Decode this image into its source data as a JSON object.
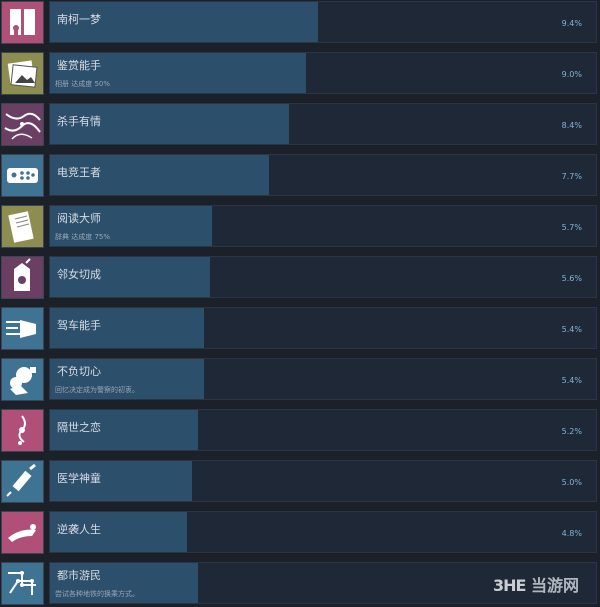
{
  "achievements": [
    {
      "title": "南柯一梦",
      "subtitle": "",
      "percent": "9.4%",
      "fill": 0.094,
      "color": "#b04f77",
      "icon": "door-icon"
    },
    {
      "title": "鉴赏能手",
      "subtitle": "相册 达成度 50%",
      "percent": "9.0%",
      "fill": 0.09,
      "color": "#8c8d4f",
      "icon": "photo-icon"
    },
    {
      "title": "杀手有情",
      "subtitle": "",
      "percent": "8.4%",
      "fill": 0.084,
      "color": "#6a3f63",
      "icon": "thorns-icon"
    },
    {
      "title": "电竞王者",
      "subtitle": "",
      "percent": "7.7%",
      "fill": 0.077,
      "color": "#3f7394",
      "icon": "gamepad-icon"
    },
    {
      "title": "阅读大师",
      "subtitle": "辞典 达成度 75%",
      "percent": "5.7%",
      "fill": 0.057,
      "color": "#8c8d4f",
      "icon": "book-icon"
    },
    {
      "title": "邻女切成",
      "subtitle": "",
      "percent": "5.6%",
      "fill": 0.056,
      "color": "#6a3f63",
      "icon": "milk-carton-icon"
    },
    {
      "title": "驾车能手",
      "subtitle": "",
      "percent": "5.4%",
      "fill": 0.054,
      "color": "#3f7394",
      "icon": "speed-icon"
    },
    {
      "title": "不负切心",
      "subtitle": "回忆决定成为警察的初衷。",
      "percent": "5.4%",
      "fill": 0.054,
      "color": "#3f7394",
      "icon": "explosion-icon"
    },
    {
      "title": "隔世之恋",
      "subtitle": "",
      "percent": "5.2%",
      "fill": 0.052,
      "color": "#b04f77",
      "icon": "swirl-icon"
    },
    {
      "title": "医学神童",
      "subtitle": "",
      "percent": "5.0%",
      "fill": 0.05,
      "color": "#3f7394",
      "icon": "syringe-icon"
    },
    {
      "title": "逆袭人生",
      "subtitle": "",
      "percent": "4.8%",
      "fill": 0.048,
      "color": "#b04f77",
      "icon": "flying-hero-icon"
    },
    {
      "title": "都市游民",
      "subtitle": "尝试各种地铁的换乘方式。",
      "percent": "",
      "fill": 0.052,
      "color": "#3f7394",
      "icon": "metro-map-icon"
    }
  ],
  "watermark": {
    "a": "3HE",
    "b": "当游网"
  }
}
